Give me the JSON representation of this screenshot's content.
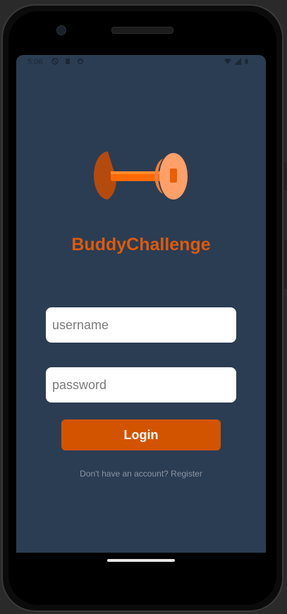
{
  "status_bar": {
    "time": "5:06",
    "left_icons": [
      "do-not-disturb-icon",
      "sd-card-icon",
      "sync-icon"
    ],
    "right_icons": [
      "wifi-icon",
      "signal-icon",
      "battery-icon"
    ]
  },
  "app": {
    "title": "BuddyChallenge",
    "logo_icon": "dumbbell-icon"
  },
  "form": {
    "username": {
      "placeholder": "username",
      "value": ""
    },
    "password": {
      "placeholder": "password",
      "value": ""
    },
    "login_label": "Login",
    "register_text": "Don't have an account? Register"
  },
  "colors": {
    "background": "#2b3d52",
    "accent": "#d35400",
    "title": "#de5a0c"
  }
}
